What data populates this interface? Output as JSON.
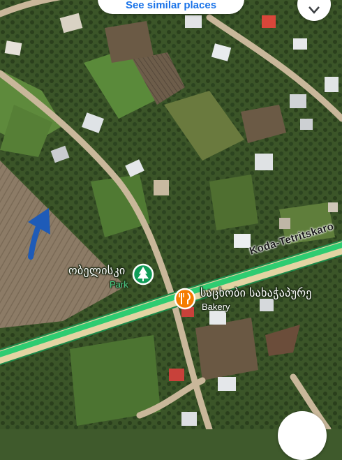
{
  "top_button": {
    "label": "See similar places"
  },
  "road": {
    "name": "Koda-Tetritskaro"
  },
  "pois": [
    {
      "name": "ობელისკი",
      "category": "Park",
      "icon": "tree-icon",
      "color": "#0f9d58"
    },
    {
      "name": "საცხობი სახაჭაპურე",
      "category": "Bakery",
      "icon": "fork-knife-icon",
      "color": "#f57c00"
    }
  ],
  "annotation": {
    "icon": "arrow-up-right-icon",
    "color": "#1e5bb8"
  },
  "colors": {
    "highlight_road": "#2ecc71",
    "accent": "#1a73e8"
  }
}
